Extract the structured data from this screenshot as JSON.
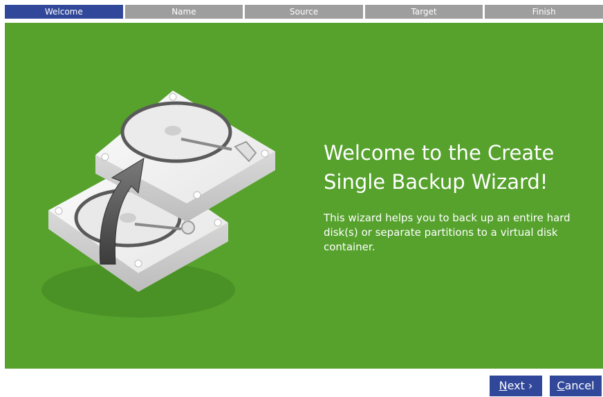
{
  "wizard": {
    "steps": [
      {
        "label": "Welcome",
        "active": true
      },
      {
        "label": "Name",
        "active": false
      },
      {
        "label": "Source",
        "active": false
      },
      {
        "label": "Target",
        "active": false
      },
      {
        "label": "Finish",
        "active": false
      }
    ]
  },
  "welcome": {
    "title_line1": "Welcome to the Create",
    "title_line2": "Single Backup Wizard!",
    "description": "This wizard helps you to back up an entire hard disk(s) or separate partitions to a virtual disk container.",
    "illustration_icon": "hard-disk-copy-icon"
  },
  "buttons": {
    "next_mnemonic": "N",
    "next_rest": "ext",
    "next_arrow": "›",
    "cancel_mnemonic": "C",
    "cancel_rest": "ancel"
  },
  "colors": {
    "panel_green": "#56a22d",
    "active_step": "#31489a",
    "inactive_step": "#9e9e9e",
    "button_blue": "#31489a"
  }
}
